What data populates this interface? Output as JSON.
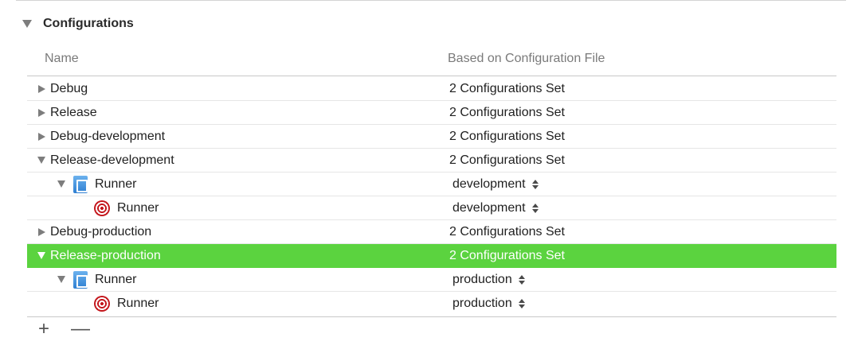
{
  "section": {
    "title": "Configurations"
  },
  "table": {
    "columns": {
      "name": "Name",
      "file": "Based on Configuration File"
    },
    "rows": [
      {
        "name": "Debug",
        "value": "2 Configurations Set"
      },
      {
        "name": "Release",
        "value": "2 Configurations Set"
      },
      {
        "name": "Debug-development",
        "value": "2 Configurations Set"
      },
      {
        "name": "Release-development",
        "value": "2 Configurations Set"
      },
      {
        "name": "Runner",
        "value": "development"
      },
      {
        "name": "Runner",
        "value": "development"
      },
      {
        "name": "Debug-production",
        "value": "2 Configurations Set"
      },
      {
        "name": "Release-production",
        "value": "2 Configurations Set"
      },
      {
        "name": "Runner",
        "value": "production"
      },
      {
        "name": "Runner",
        "value": "production"
      }
    ]
  },
  "footer": {
    "add_label": "+",
    "remove_label": "—"
  },
  "colors": {
    "selection": "#5bd33f",
    "target_icon": "#c4161c",
    "project_icon": "#2e7fd2"
  },
  "icons": {
    "collapsed": "disclosure-right-icon",
    "expanded": "disclosure-down-icon",
    "project": "project-file-icon",
    "target": "target-icon",
    "stepper": "stepper-icon"
  }
}
